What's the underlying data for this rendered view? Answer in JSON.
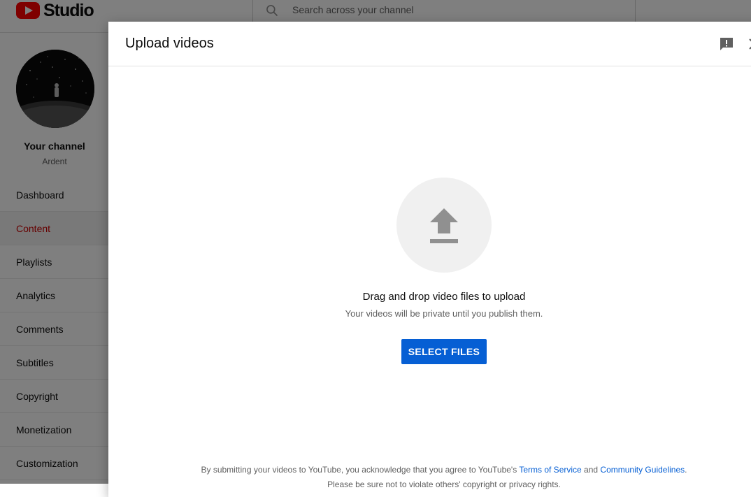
{
  "app": {
    "logo_text": "Studio",
    "brand_color": "#ff0000"
  },
  "search": {
    "placeholder": "Search across your channel"
  },
  "sidebar": {
    "channel_title": "Your channel",
    "channel_name": "Ardent",
    "items": [
      {
        "label": "Dashboard",
        "active": false
      },
      {
        "label": "Content",
        "active": true
      },
      {
        "label": "Playlists",
        "active": false
      },
      {
        "label": "Analytics",
        "active": false
      },
      {
        "label": "Comments",
        "active": false
      },
      {
        "label": "Subtitles",
        "active": false
      },
      {
        "label": "Copyright",
        "active": false
      },
      {
        "label": "Monetization",
        "active": false
      },
      {
        "label": "Customization",
        "active": false
      }
    ]
  },
  "dialog": {
    "title": "Upload videos",
    "icons": {
      "feedback": "feedback-icon",
      "close": "close-icon",
      "upload": "upload-arrow-icon"
    },
    "drop_title": "Drag and drop video files to upload",
    "drop_subtitle": "Your videos will be private until you publish them.",
    "select_button": "SELECT FILES",
    "legal": {
      "prefix": "By submitting your videos to YouTube, you acknowledge that you agree to YouTube's",
      "terms_link": "Terms of Service",
      "conjunction": "and",
      "guidelines_link": "Community Guidelines",
      "suffix": "."
    },
    "legal_line2": "Please be sure not to violate others' copyright or privacy rights."
  },
  "colors": {
    "accent": "#065fd4",
    "active_nav": "#cc0000"
  }
}
